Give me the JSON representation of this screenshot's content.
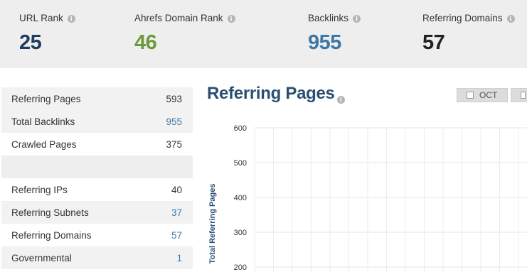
{
  "metrics": [
    {
      "label": "URL Rank",
      "value": "25",
      "color": "#1d3d5c"
    },
    {
      "label": "Ahrefs Domain Rank",
      "value": "46",
      "color": "#6a9a3a"
    },
    {
      "label": "Backlinks",
      "value": "955",
      "color": "#3d78a8"
    },
    {
      "label": "Referring Domains",
      "value": "57",
      "color": "#222222"
    }
  ],
  "stats": [
    {
      "label": "Referring Pages",
      "value": "593",
      "link": false
    },
    {
      "label": "Total Backlinks",
      "value": "955",
      "link": true
    },
    {
      "label": "Crawled Pages",
      "value": "375",
      "link": false
    },
    {
      "label": "",
      "value": "",
      "link": false
    },
    {
      "label": "Referring IPs",
      "value": "40",
      "link": false
    },
    {
      "label": "Referring Subnets",
      "value": "37",
      "link": true
    },
    {
      "label": "Referring Domains",
      "value": "57",
      "link": true
    },
    {
      "label": "Governmental",
      "value": "1",
      "link": true
    }
  ],
  "chart": {
    "title": "Referring Pages",
    "toggle_label": "OCT"
  },
  "chart_data": {
    "type": "line",
    "title": "Referring Pages",
    "ylabel": "Total Referring Pages",
    "xlabel": "",
    "ylim": [
      200,
      600
    ],
    "yticks": [
      600,
      500,
      400,
      300,
      200
    ],
    "grid": true,
    "series": []
  }
}
